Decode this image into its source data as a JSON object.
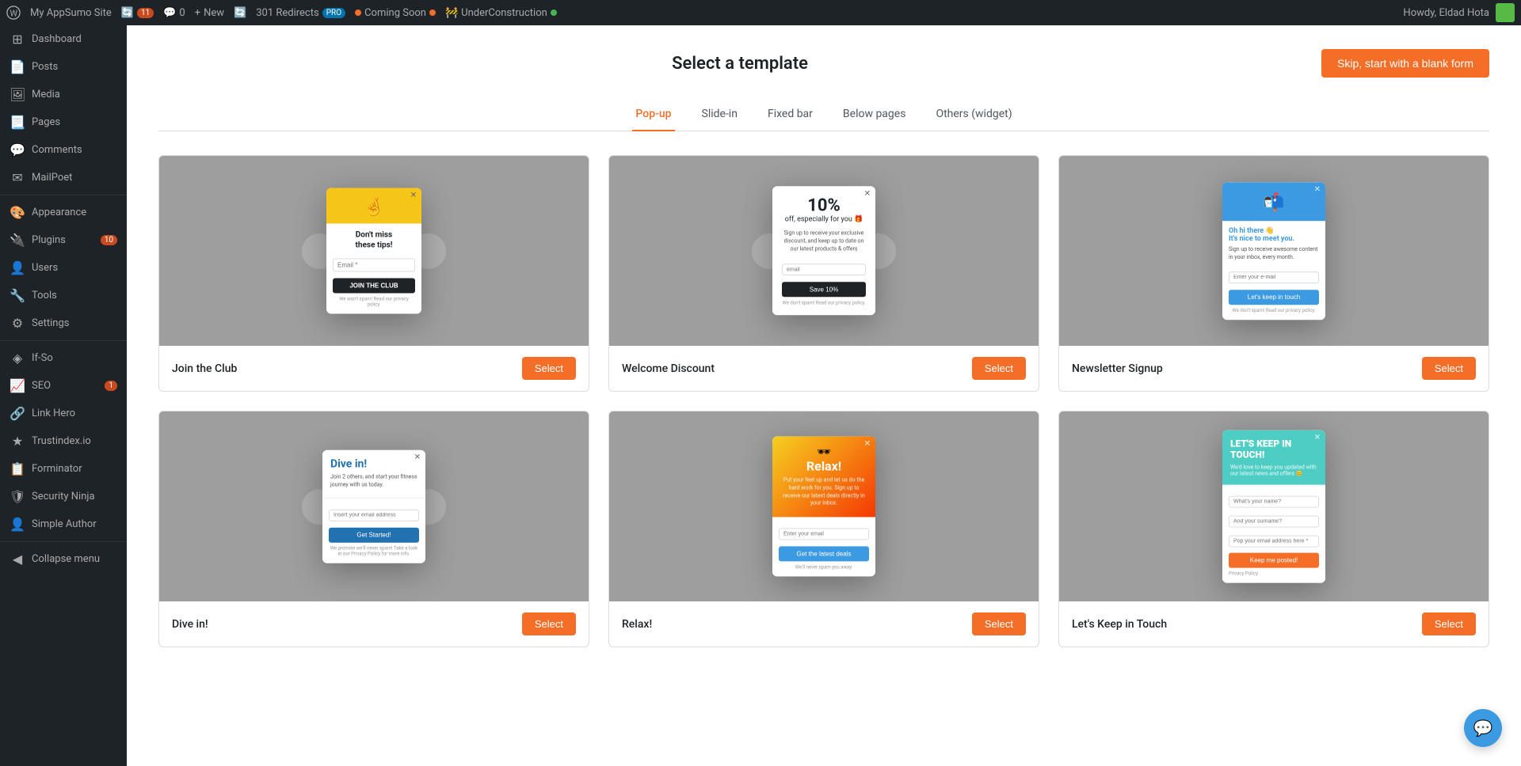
{
  "adminBar": {
    "siteName": "My AppSumo Site",
    "updateCount": "11",
    "commentCount": "0",
    "newLabel": "New",
    "plugin1": "301 Redirects",
    "plugin1Badge": "PRO",
    "plugin2": "Coming Soon",
    "plugin3": "UnderConstruction",
    "userGreeting": "Howdy, Eldad Hota"
  },
  "sidebar": {
    "items": [
      {
        "id": "dashboard",
        "label": "Dashboard",
        "icon": "⊞"
      },
      {
        "id": "posts",
        "label": "Posts",
        "icon": "📄"
      },
      {
        "id": "media",
        "label": "Media",
        "icon": "🖼"
      },
      {
        "id": "pages",
        "label": "Pages",
        "icon": "📃"
      },
      {
        "id": "comments",
        "label": "Comments",
        "icon": "💬"
      },
      {
        "id": "mailpoet",
        "label": "MailPoet",
        "icon": "✉"
      },
      {
        "id": "appearance",
        "label": "Appearance",
        "icon": "🎨"
      },
      {
        "id": "plugins",
        "label": "Plugins",
        "icon": "🔌",
        "badge": "10"
      },
      {
        "id": "users",
        "label": "Users",
        "icon": "👤"
      },
      {
        "id": "tools",
        "label": "Tools",
        "icon": "🔧"
      },
      {
        "id": "settings",
        "label": "Settings",
        "icon": "⚙"
      },
      {
        "id": "if-so",
        "label": "If-So",
        "icon": "◈"
      },
      {
        "id": "seo",
        "label": "SEO",
        "icon": "📈",
        "badge": "1"
      },
      {
        "id": "link-hero",
        "label": "Link Hero",
        "icon": "🔗"
      },
      {
        "id": "trustindex",
        "label": "Trustindex.io",
        "icon": "★"
      },
      {
        "id": "forminator",
        "label": "Forminator",
        "icon": "📋"
      },
      {
        "id": "security-ninja",
        "label": "Security Ninja",
        "icon": "🛡"
      },
      {
        "id": "simple-author",
        "label": "Simple Author",
        "icon": "👤"
      },
      {
        "id": "collapse",
        "label": "Collapse menu",
        "icon": "◀"
      }
    ]
  },
  "page": {
    "title": "Select a template",
    "skipButton": "Skip, start with a blank form"
  },
  "tabs": [
    {
      "id": "popup",
      "label": "Pop-up",
      "active": true
    },
    {
      "id": "slide-in",
      "label": "Slide-in",
      "active": false
    },
    {
      "id": "fixed-bar",
      "label": "Fixed bar",
      "active": false
    },
    {
      "id": "below-pages",
      "label": "Below pages",
      "active": false
    },
    {
      "id": "others",
      "label": "Others (widget)",
      "active": false
    }
  ],
  "templates": [
    {
      "id": "join-the-club",
      "name": "Join the Club",
      "selectLabel": "Select"
    },
    {
      "id": "welcome-discount",
      "name": "Welcome Discount",
      "selectLabel": "Select"
    },
    {
      "id": "newsletter-signup",
      "name": "Newsletter Signup",
      "selectLabel": "Select"
    },
    {
      "id": "dive-in",
      "name": "Dive in!",
      "selectLabel": "Select"
    },
    {
      "id": "relax",
      "name": "Relax!",
      "selectLabel": "Select"
    },
    {
      "id": "keep-in-touch",
      "name": "Let's Keep in Touch",
      "selectLabel": "Select"
    }
  ],
  "chat": {
    "icon": "💬"
  }
}
